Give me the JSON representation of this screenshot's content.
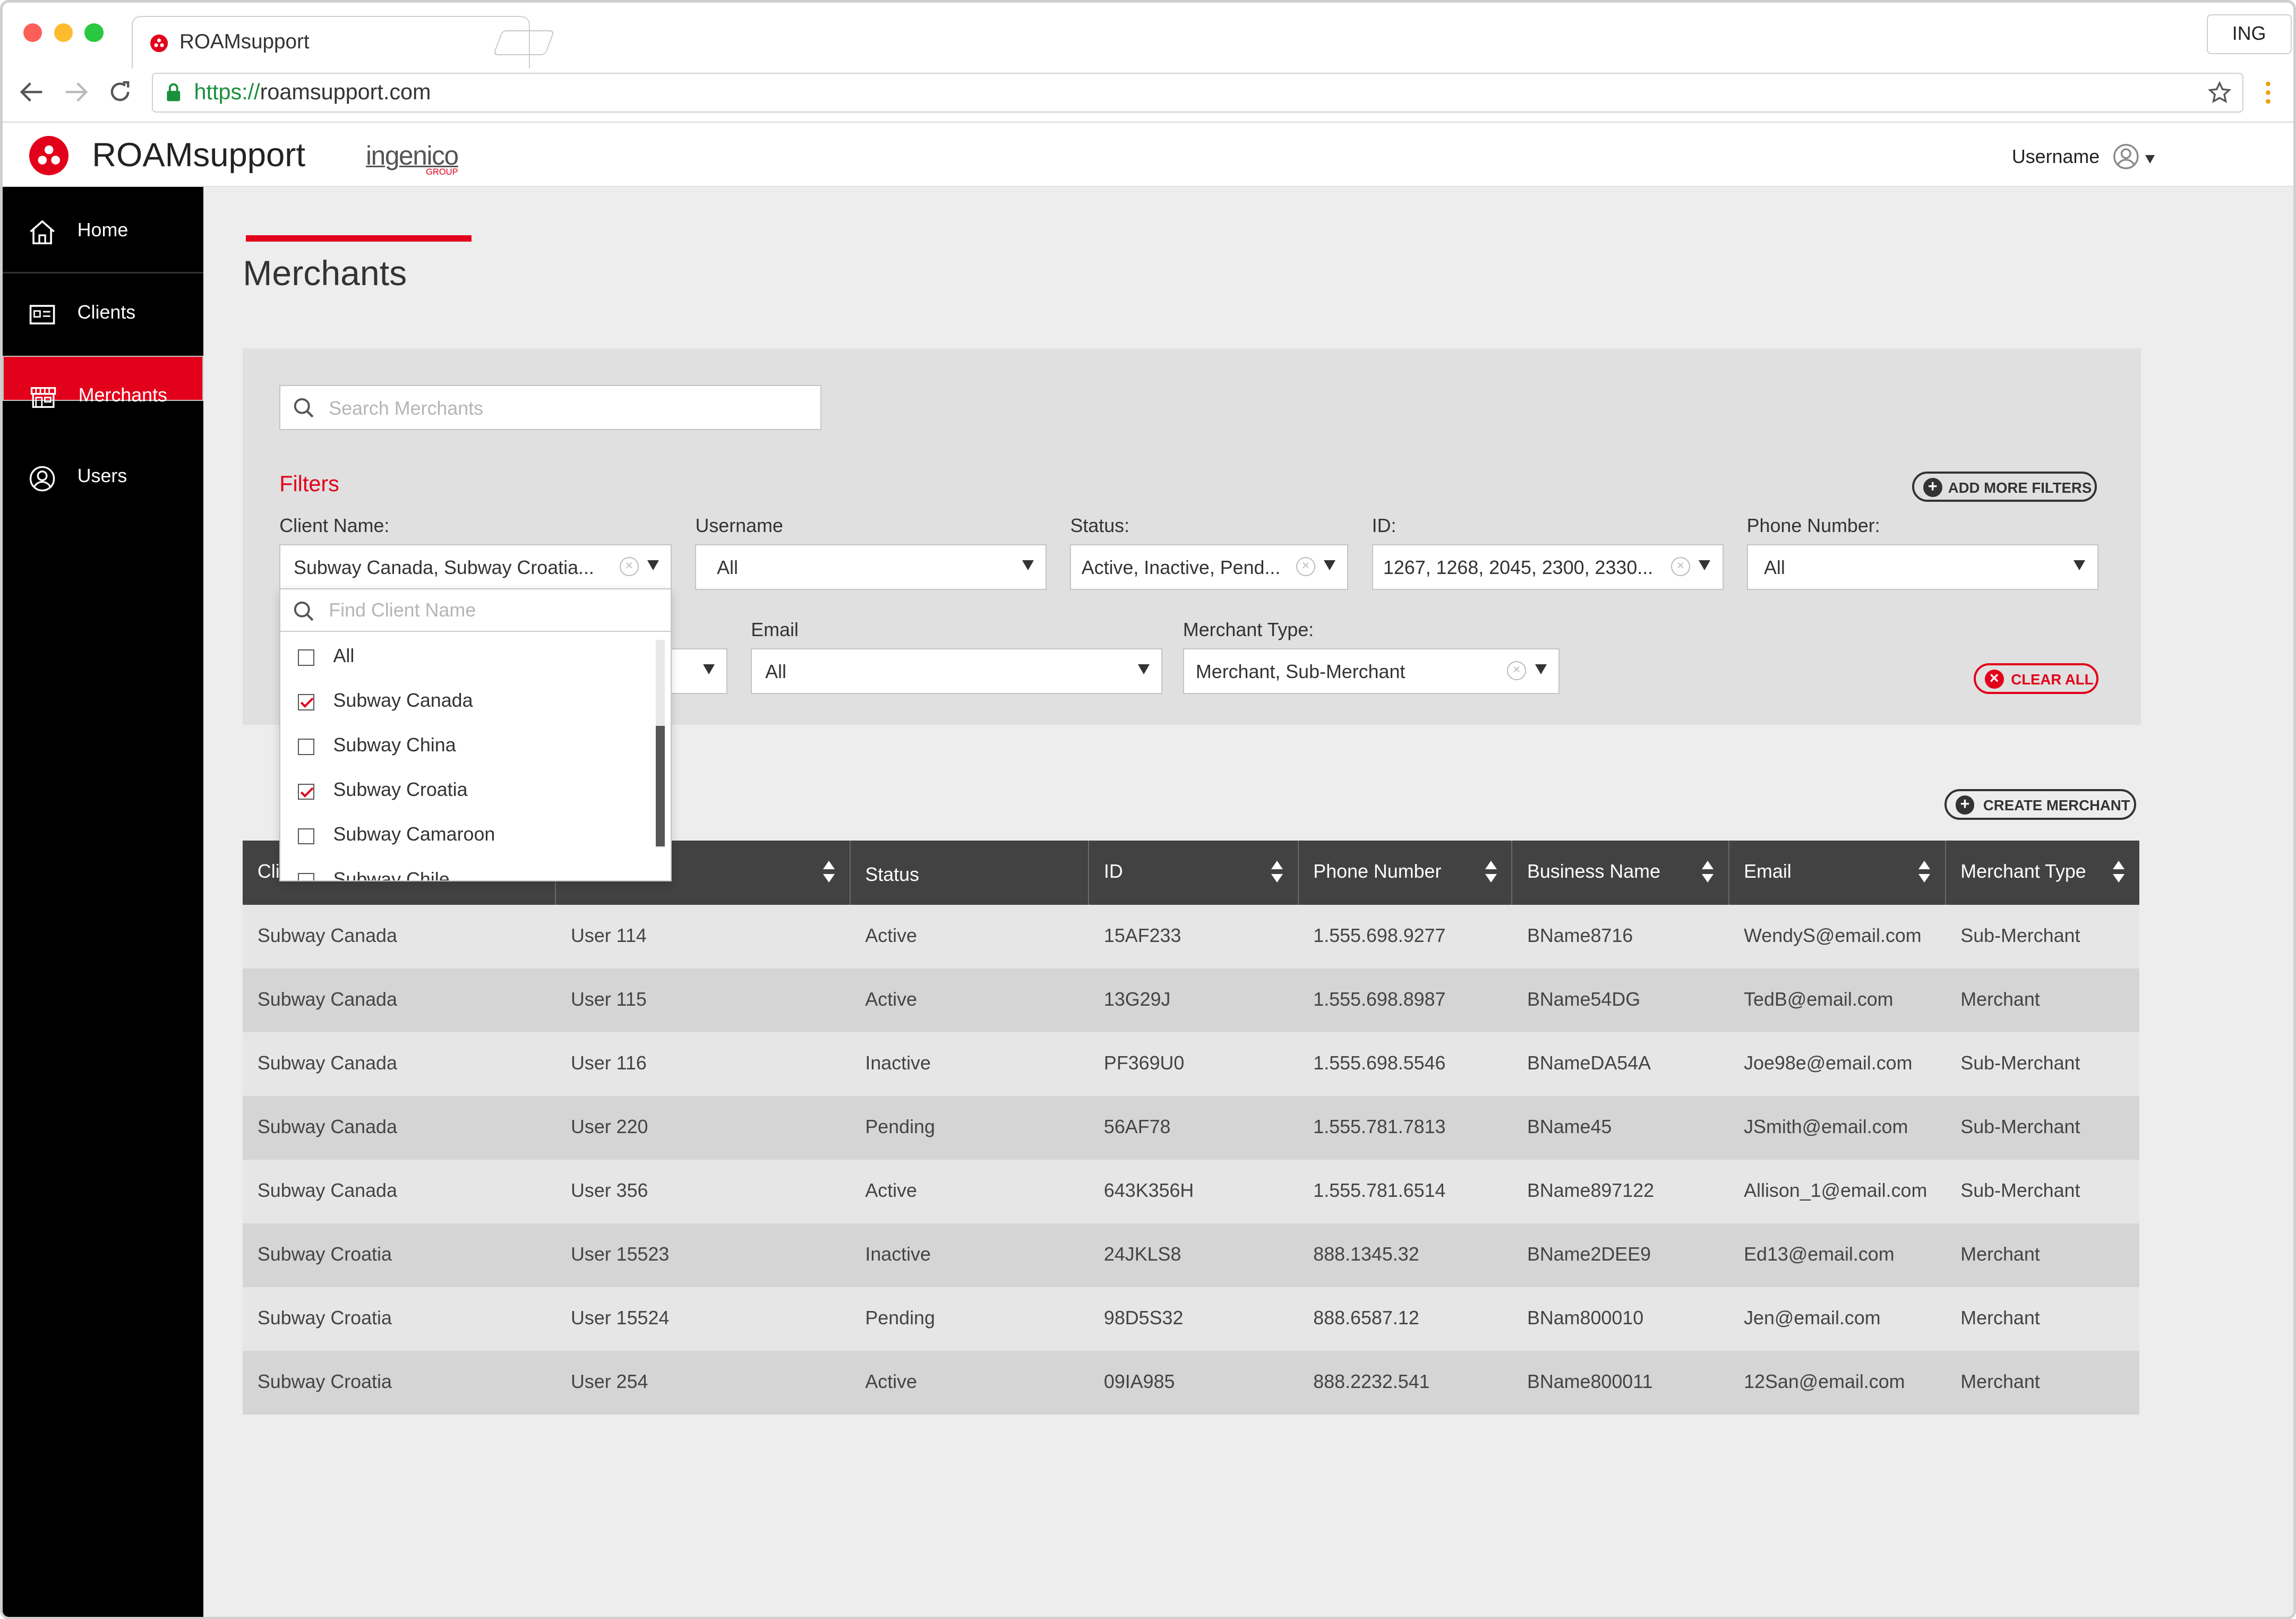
{
  "browser": {
    "tab_title": "ROAMsupport",
    "profile": "ING",
    "url_scheme": "https://",
    "url_host": "roamsupport.com"
  },
  "app": {
    "brand": "ROAMsupport",
    "partner_logo": "ingenico",
    "partner_sub": "GROUP",
    "username": "Username",
    "accent": "#e2001a"
  },
  "sidebar": {
    "items": [
      {
        "label": "Home",
        "icon": "home-icon"
      },
      {
        "label": "Clients",
        "icon": "clients-icon"
      },
      {
        "label": "Merchants",
        "icon": "merchants-icon"
      },
      {
        "label": "Users",
        "icon": "users-icon"
      }
    ]
  },
  "page": {
    "title": "Merchants"
  },
  "filters": {
    "search_placeholder": "Search Merchants",
    "title": "Filters",
    "add_more": "ADD MORE FILTERS",
    "clear_all": "CLEAR ALL",
    "client_name": {
      "label": "Client Name:",
      "value": "Subway Canada, Subway Croatia..."
    },
    "username": {
      "label": "Username",
      "value": "All"
    },
    "status": {
      "label": "Status:",
      "value": "Active, Inactive, Pend..."
    },
    "id": {
      "label": "ID:",
      "value": "1267, 1268, 2045, 2300, 2330..."
    },
    "phone": {
      "label": "Phone Number:",
      "value": "All"
    },
    "email": {
      "label": "Email",
      "value": "All"
    },
    "merchant_type": {
      "label": "Merchant Type:",
      "value": "Merchant, Sub-Merchant"
    }
  },
  "client_dropdown": {
    "find_placeholder": "Find Client Name",
    "options": [
      {
        "label": "All",
        "checked": false
      },
      {
        "label": "Subway Canada",
        "checked": true
      },
      {
        "label": "Subway China",
        "checked": false
      },
      {
        "label": "Subway Croatia",
        "checked": true
      },
      {
        "label": "Subway Camaroon",
        "checked": false
      },
      {
        "label": "Subway Chile",
        "checked": false
      }
    ]
  },
  "create_merchant": "CREATE MERCHANT",
  "table": {
    "headers": [
      "Cli",
      "",
      "Status",
      "ID",
      "Phone Number",
      "Business Name",
      "Email",
      "Merchant Type"
    ],
    "rows": [
      [
        "Subway Canada",
        "User 114",
        "Active",
        "15AF233",
        "1.555.698.9277",
        "BName8716",
        "WendyS@email.com",
        "Sub-Merchant"
      ],
      [
        "Subway Canada",
        "User 115",
        "Active",
        "13G29J",
        "1.555.698.8987",
        "BName54DG",
        "TedB@email.com",
        "Merchant"
      ],
      [
        "Subway Canada",
        "User 116",
        "Inactive",
        "PF369U0",
        "1.555.698.5546",
        "BNameDA54A",
        "Joe98e@email.com",
        "Sub-Merchant"
      ],
      [
        "Subway Canada",
        "User 220",
        "Pending",
        "56AF78",
        "1.555.781.7813",
        "BName45",
        "JSmith@email.com",
        "Sub-Merchant"
      ],
      [
        "Subway Canada",
        "User 356",
        "Active",
        "643K356H",
        "1.555.781.6514",
        "BName897122",
        "Allison_1@email.com",
        "Sub-Merchant"
      ],
      [
        "Subway Croatia",
        "User 15523",
        "Inactive",
        "24JKLS8",
        "888.1345.32",
        "BName2DEE9",
        "Ed13@email.com",
        "Merchant"
      ],
      [
        "Subway Croatia",
        "User 15524",
        "Pending",
        "98D5S32",
        "888.6587.12",
        "BNam800010",
        "Jen@email.com",
        "Merchant"
      ],
      [
        "Subway Croatia",
        "User 254",
        "Active",
        "09IA985",
        "888.2232.541",
        "BName800011",
        "12San@email.com",
        "Merchant"
      ]
    ]
  }
}
